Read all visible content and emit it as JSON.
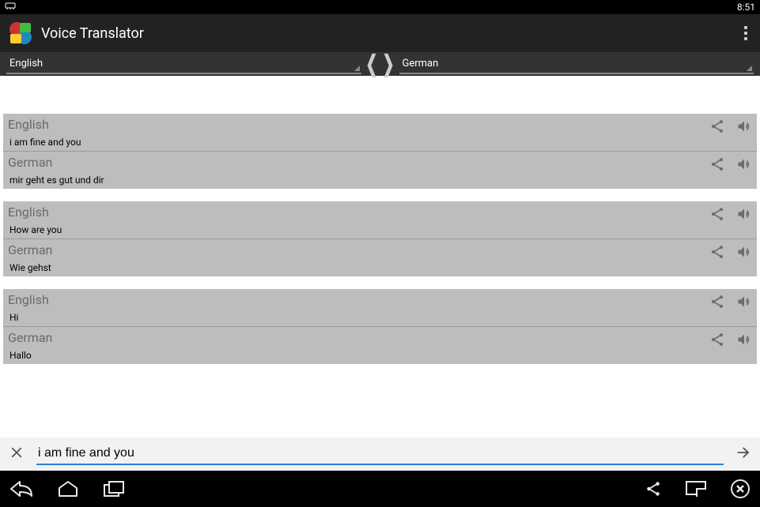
{
  "status": {
    "time": "8:51"
  },
  "app": {
    "title": "Voice Translator"
  },
  "langs": {
    "source": "English",
    "target": "German"
  },
  "groups": [
    {
      "rows": [
        {
          "lang": "English",
          "text": "i am fine and you"
        },
        {
          "lang": "German",
          "text": "mir geht es gut und dir"
        }
      ]
    },
    {
      "rows": [
        {
          "lang": "English",
          "text": "How are you"
        },
        {
          "lang": "German",
          "text": "Wie gehst"
        }
      ]
    },
    {
      "rows": [
        {
          "lang": "English",
          "text": "Hi"
        },
        {
          "lang": "German",
          "text": "Hallo"
        }
      ]
    }
  ],
  "input": {
    "value": "i am fine and you"
  }
}
